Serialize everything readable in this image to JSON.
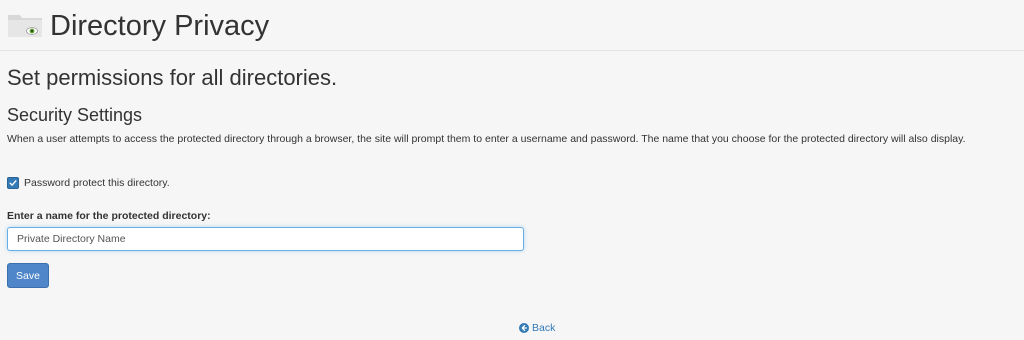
{
  "header": {
    "title": "Directory Privacy",
    "icon": "folder-eye-icon"
  },
  "main": {
    "subtitle": "Set permissions for all directories.",
    "section_heading": "Security Settings",
    "description": "When a user attempts to access the protected directory through a browser, the site will prompt them to enter a username and password. The name that you choose for the protected directory will also display.",
    "password_protect": {
      "label": "Password protect this directory.",
      "checked": true
    },
    "name_field": {
      "label": "Enter a name for the protected directory:",
      "value": "Private Directory Name"
    },
    "save_label": "Save",
    "back_label": "Back"
  },
  "colors": {
    "accent": "#337ab7",
    "button": "#4e86c9",
    "background": "#f6f6f6"
  }
}
